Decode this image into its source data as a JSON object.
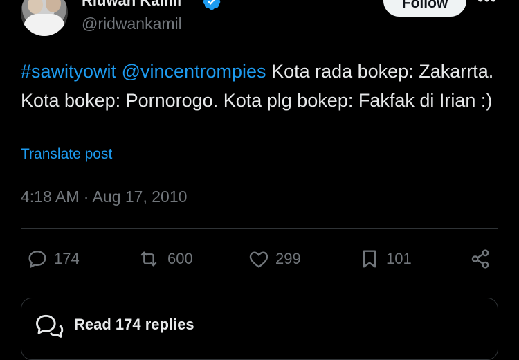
{
  "author": {
    "name": "Ridwan Kamil",
    "handle": "@ridwankamil",
    "verified": true
  },
  "follow_label": "Follow",
  "tweet": {
    "hashtag": "#sawityowit",
    "mention": "@vincentrompies",
    "text": " Kota rada bokep: Zakarrta. Kota bokep: Pornorogo. Kota plg bokep: Fakfak di Irian :)",
    "translate_label": "Translate post",
    "timestamp": "4:18 AM · Aug 17, 2010"
  },
  "actions": {
    "replies": "174",
    "reposts": "600",
    "likes": "299",
    "bookmarks": "101"
  },
  "read_replies_label": "Read 174 replies",
  "colors": {
    "background": "#000000",
    "text": "#e7e9ea",
    "muted": "#71767b",
    "link": "#1d9bf0",
    "border": "#2f3336"
  },
  "icons": [
    "verified-badge-icon",
    "more-icon",
    "reply-icon",
    "repost-icon",
    "like-icon",
    "bookmark-icon",
    "share-icon",
    "chat-bubble-icon"
  ]
}
